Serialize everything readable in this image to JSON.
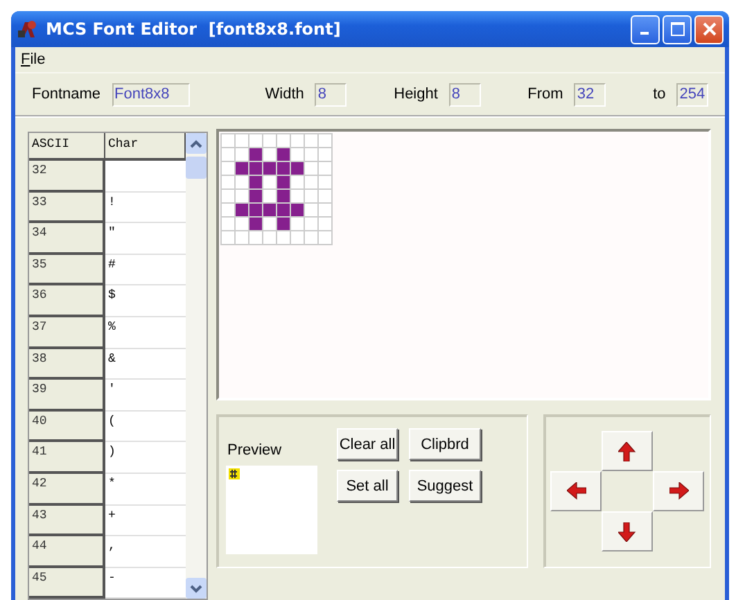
{
  "window": {
    "title": "MCS Font Editor  [font8x8.font]"
  },
  "menu": [
    {
      "label": "File"
    }
  ],
  "fields": [
    {
      "label": "Fontname",
      "value": "Font8x8"
    },
    {
      "label": "Width",
      "value": "8"
    },
    {
      "label": "Height",
      "value": "8"
    },
    {
      "label": "From",
      "value": "32"
    },
    {
      "label": "to",
      "value": "254"
    }
  ],
  "table": {
    "columns": [
      "ASCII",
      "Char"
    ],
    "rows": [
      {
        "ascii": "32"
      },
      {
        "ascii": "33",
        "char": "!"
      },
      {
        "ascii": "34",
        "char": "\""
      },
      {
        "ascii": "35",
        "char": "#"
      },
      {
        "ascii": "36",
        "char": "$"
      },
      {
        "ascii": "37",
        "char": "%"
      },
      {
        "ascii": "38",
        "char": "&"
      },
      {
        "ascii": "39",
        "char": "'"
      },
      {
        "ascii": "40",
        "char": "("
      },
      {
        "ascii": "41",
        "char": ")"
      },
      {
        "ascii": "42",
        "char": "*"
      },
      {
        "ascii": "43",
        "char": "+"
      },
      {
        "ascii": "44",
        "char": ","
      },
      {
        "ascii": "45",
        "char": "-"
      }
    ]
  },
  "glyph": {
    "pixels": [
      [
        false,
        false,
        false,
        false,
        false,
        false,
        false,
        false
      ],
      [
        false,
        false,
        true,
        false,
        true,
        false,
        false,
        false
      ],
      [
        false,
        true,
        true,
        true,
        true,
        true,
        false,
        false
      ],
      [
        false,
        false,
        true,
        false,
        true,
        false,
        false,
        false
      ],
      [
        false,
        false,
        true,
        false,
        true,
        false,
        false,
        false
      ],
      [
        false,
        true,
        true,
        true,
        true,
        true,
        false,
        false
      ],
      [
        false,
        false,
        true,
        false,
        true,
        false,
        false,
        false
      ],
      [
        false,
        false,
        false,
        false,
        false,
        false,
        false,
        false
      ]
    ]
  },
  "preview": {
    "label": "Preview"
  },
  "buttons": [
    "Clear all",
    "Clipbrd",
    "Set all",
    "Suggest"
  ],
  "arrows": [
    {
      "kind": "up"
    },
    {
      "kind": "left"
    },
    {
      "kind": "right"
    },
    {
      "kind": "down"
    }
  ]
}
